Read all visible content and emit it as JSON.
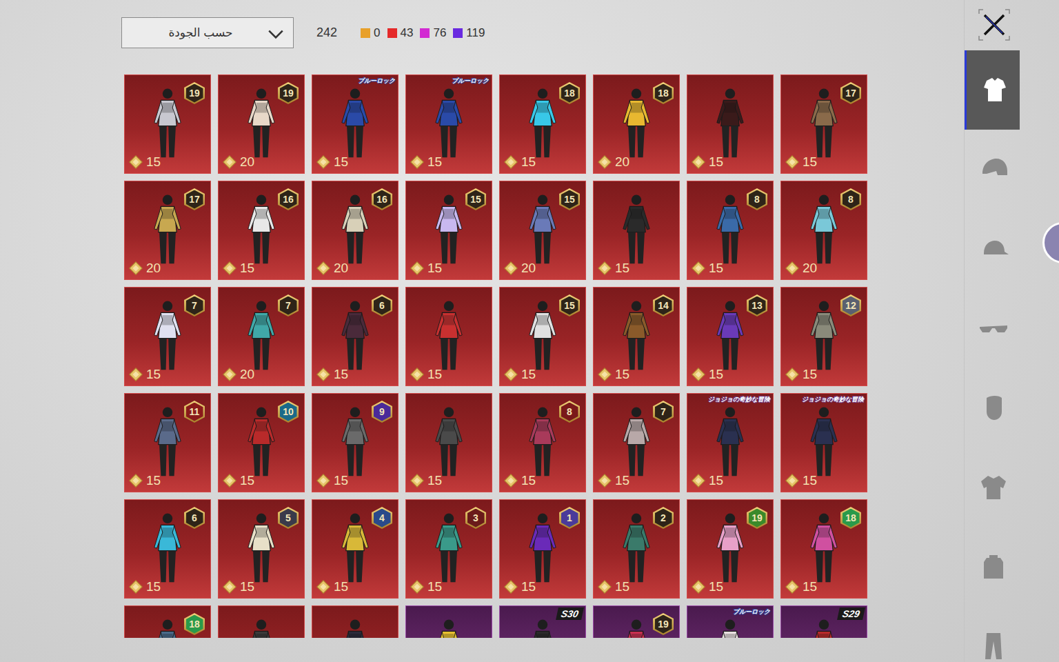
{
  "sort_dropdown": {
    "label": "حسب الجودة"
  },
  "total": "242",
  "legend": [
    {
      "count": "0",
      "color": "#e8a02a"
    },
    {
      "count": "43",
      "color": "#e52a2a"
    },
    {
      "count": "76",
      "color": "#d22ad2"
    },
    {
      "count": "119",
      "color": "#6a2ae0"
    }
  ],
  "sidebar": {
    "tabs": [
      {
        "selected": true
      },
      {
        "selected": false
      },
      {
        "selected": false
      },
      {
        "selected": false
      },
      {
        "selected": false
      },
      {
        "selected": false
      },
      {
        "selected": false
      },
      {
        "selected": false
      }
    ]
  },
  "items": [
    {
      "badge_kind": "level",
      "badge": "19",
      "badge_color": "#2e2418",
      "price": "15",
      "quality": "red",
      "color": "#c8c8d0"
    },
    {
      "badge_kind": "level",
      "badge": "19",
      "badge_color": "#2e2418",
      "price": "20",
      "quality": "red",
      "color": "#e8d8c8"
    },
    {
      "badge_kind": "logo",
      "badge": "ブルーロック",
      "badge_color": "#2a4aa8",
      "price": "15",
      "quality": "red",
      "color": "#2a4aa8"
    },
    {
      "badge_kind": "logo",
      "badge": "ブルーロック",
      "badge_color": "#2a4aa8",
      "price": "15",
      "quality": "red",
      "color": "#2a4aa8"
    },
    {
      "badge_kind": "level",
      "badge": "18",
      "badge_color": "#2e2418",
      "price": "15",
      "quality": "red",
      "color": "#38c8e8"
    },
    {
      "badge_kind": "level",
      "badge": "18",
      "badge_color": "#2e2418",
      "price": "20",
      "quality": "red",
      "color": "#e8b830"
    },
    {
      "badge_kind": "none",
      "badge": "",
      "badge_color": "#2e2418",
      "price": "15",
      "quality": "red",
      "color": "#3a1a1a"
    },
    {
      "badge_kind": "level",
      "badge": "17",
      "badge_color": "#2e2418",
      "price": "15",
      "quality": "red",
      "color": "#8a6a4a"
    },
    {
      "badge_kind": "level",
      "badge": "17",
      "badge_color": "#2e2418",
      "price": "20",
      "quality": "red",
      "color": "#c8a850"
    },
    {
      "badge_kind": "level",
      "badge": "16",
      "badge_color": "#2e2418",
      "price": "15",
      "quality": "red",
      "color": "#e8e8e8"
    },
    {
      "badge_kind": "level",
      "badge": "16",
      "badge_color": "#2e2418",
      "price": "20",
      "quality": "red",
      "color": "#d8d0b8"
    },
    {
      "badge_kind": "level",
      "badge": "15",
      "badge_color": "#2e2418",
      "price": "15",
      "quality": "red",
      "color": "#c8b8f0"
    },
    {
      "badge_kind": "level",
      "badge": "15",
      "badge_color": "#2e2418",
      "price": "20",
      "quality": "red",
      "color": "#6a7ab8"
    },
    {
      "badge_kind": "none",
      "badge": "",
      "badge_color": "#2e2418",
      "price": "15",
      "quality": "red",
      "color": "#2a2a2a"
    },
    {
      "badge_kind": "level",
      "badge": "8",
      "badge_color": "#2e2418",
      "price": "15",
      "quality": "red",
      "color": "#3a6aa8"
    },
    {
      "badge_kind": "level",
      "badge": "8",
      "badge_color": "#2e2418",
      "price": "20",
      "quality": "red",
      "color": "#7ac8d8"
    },
    {
      "badge_kind": "level",
      "badge": "7",
      "badge_color": "#2e2418",
      "price": "15",
      "quality": "red",
      "color": "#e0e0f0"
    },
    {
      "badge_kind": "level",
      "badge": "7",
      "badge_color": "#2e2418",
      "price": "20",
      "quality": "red",
      "color": "#40a8a8"
    },
    {
      "badge_kind": "level",
      "badge": "6",
      "badge_color": "#2e2418",
      "price": "15",
      "quality": "red",
      "color": "#4a2a3a"
    },
    {
      "badge_kind": "none",
      "badge": "",
      "badge_color": "#2e2418",
      "price": "15",
      "quality": "red",
      "color": "#c83030"
    },
    {
      "badge_kind": "level",
      "badge": "15",
      "badge_color": "#2e2418",
      "price": "15",
      "quality": "red",
      "color": "#e0e0e0"
    },
    {
      "badge_kind": "level",
      "badge": "14",
      "badge_color": "#2e2418",
      "price": "15",
      "quality": "red",
      "color": "#8a5a2a"
    },
    {
      "badge_kind": "level",
      "badge": "13",
      "badge_color": "#2e2418",
      "price": "15",
      "quality": "red",
      "color": "#6a3ab8"
    },
    {
      "badge_kind": "level",
      "badge": "12",
      "badge_color": "#5a6070",
      "price": "15",
      "quality": "red",
      "color": "#8a8a7a"
    },
    {
      "badge_kind": "level",
      "badge": "11",
      "badge_color": "#8a1a1a",
      "price": "15",
      "quality": "red",
      "color": "#5a6a8a"
    },
    {
      "badge_kind": "level",
      "badge": "10",
      "badge_color": "#1a6a8a",
      "price": "15",
      "quality": "red",
      "color": "#b82a2a"
    },
    {
      "badge_kind": "level",
      "badge": "9",
      "badge_color": "#4a2a9a",
      "price": "15",
      "quality": "red",
      "color": "#6a6a6a"
    },
    {
      "badge_kind": "none",
      "badge": "",
      "badge_color": "#2e2418",
      "price": "15",
      "quality": "red",
      "color": "#4a4a4a"
    },
    {
      "badge_kind": "level",
      "badge": "8",
      "badge_color": "#7a1a1a",
      "price": "15",
      "quality": "red",
      "color": "#a83a5a"
    },
    {
      "badge_kind": "level",
      "badge": "7",
      "badge_color": "#2e2418",
      "price": "15",
      "quality": "red",
      "color": "#b8a8a8"
    },
    {
      "badge_kind": "logo",
      "badge": "ジョジョの奇妙な冒険",
      "badge_color": "#6a3a8a",
      "price": "15",
      "quality": "red",
      "color": "#2a3050"
    },
    {
      "badge_kind": "logo",
      "badge": "ジョジョの奇妙な冒険",
      "badge_color": "#6a3a8a",
      "price": "15",
      "quality": "red",
      "color": "#2a3050"
    },
    {
      "badge_kind": "level",
      "badge": "6",
      "badge_color": "#2e2418",
      "price": "15",
      "quality": "red",
      "color": "#3ab8d8"
    },
    {
      "badge_kind": "level",
      "badge": "5",
      "badge_color": "#3a3a4a",
      "price": "15",
      "quality": "red",
      "color": "#e8e0c8"
    },
    {
      "badge_kind": "level",
      "badge": "4",
      "badge_color": "#2a4a8a",
      "price": "15",
      "quality": "red",
      "color": "#d8b838"
    },
    {
      "badge_kind": "level",
      "badge": "3",
      "badge_color": "#6a1a1a",
      "price": "15",
      "quality": "red",
      "color": "#3a9a8a"
    },
    {
      "badge_kind": "level",
      "badge": "1",
      "badge_color": "#4a3a9a",
      "price": "15",
      "quality": "red",
      "color": "#6a2ab8"
    },
    {
      "badge_kind": "level",
      "badge": "2",
      "badge_color": "#2e2418",
      "price": "15",
      "quality": "red",
      "color": "#3a7a6a"
    },
    {
      "badge_kind": "level",
      "badge": "19",
      "badge_color": "#3a8a2a",
      "price": "15",
      "quality": "red",
      "color": "#e8a0c8"
    },
    {
      "badge_kind": "level",
      "badge": "18",
      "badge_color": "#2a9a4a",
      "price": "15",
      "quality": "red",
      "color": "#d050a0"
    },
    {
      "badge_kind": "level",
      "badge": "18",
      "badge_color": "#2a9a4a",
      "price": "",
      "quality": "red",
      "color": "#4a6a8a"
    },
    {
      "badge_kind": "none",
      "badge": "",
      "badge_color": "#2e2418",
      "price": "",
      "quality": "red",
      "color": "#3a3a3a"
    },
    {
      "badge_kind": "none",
      "badge": "",
      "badge_color": "#2e2418",
      "price": "",
      "quality": "red",
      "color": "#2a2a3a"
    },
    {
      "badge_kind": "none",
      "badge": "",
      "badge_color": "#2e2418",
      "price": "",
      "quality": "purple",
      "color": "#e8c030"
    },
    {
      "badge_kind": "season",
      "badge": "S30",
      "badge_color": "#1a1a1a",
      "price": "",
      "quality": "purple",
      "color": "#2a2a2a"
    },
    {
      "badge_kind": "level",
      "badge": "19",
      "badge_color": "#2e2418",
      "price": "",
      "quality": "purple",
      "color": "#c83050"
    },
    {
      "badge_kind": "logo",
      "badge": "ブルーロック",
      "badge_color": "#2a4aa8",
      "price": "",
      "quality": "purple",
      "color": "#e8e0e0"
    },
    {
      "badge_kind": "season",
      "badge": "S29",
      "badge_color": "#1a1a1a",
      "price": "",
      "quality": "purple",
      "color": "#b82a2a"
    }
  ]
}
